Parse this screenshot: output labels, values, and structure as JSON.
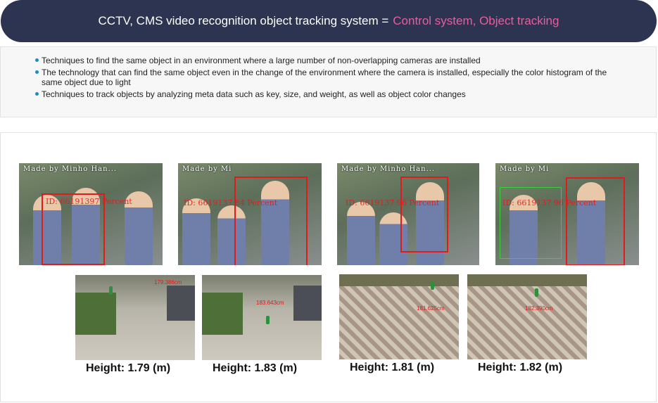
{
  "header": {
    "title_main": "CCTV, CMS video recognition object tracking system =",
    "title_highlight": "Control system, Object tracking"
  },
  "bullets": [
    "Techniques to find the same object in an environment where a large number of non-overlapping cameras are installed",
    "The technology that can find the same object even in the change of the environment where the camera is installed, especially the color histogram of the same object due to light",
    "Techniques to track objects by analyzing meta data such as key, size, and weight, as well as object color changes"
  ],
  "tracking_frames": [
    {
      "caption": "Made by Minho Han...",
      "id_text": "ID: 66191397  Percent"
    },
    {
      "caption": "Made by Mi",
      "id_text": "ID: 6619137   84 Percent"
    },
    {
      "caption": "Made by Minho Han...",
      "id_text": "ID: 6619137   96 Percent"
    },
    {
      "caption": "Made by Mi",
      "id_text": "ID: 6619137   96 Percent"
    }
  ],
  "height_frames": [
    {
      "measure": "179.386cm",
      "label": "Height: 1.79 (m)"
    },
    {
      "measure": "183.643cm",
      "label": "Height: 1.83 (m)"
    },
    {
      "measure": "181.625cm",
      "label": "Height: 1.81 (m)"
    },
    {
      "measure": "182.390cm",
      "label": "Height: 1.82 (m)"
    }
  ],
  "colors": {
    "header_bg": "#2c3451",
    "highlight": "#e85e9b",
    "bullet": "#1e8bbf",
    "track_box": "#e11b1b"
  }
}
